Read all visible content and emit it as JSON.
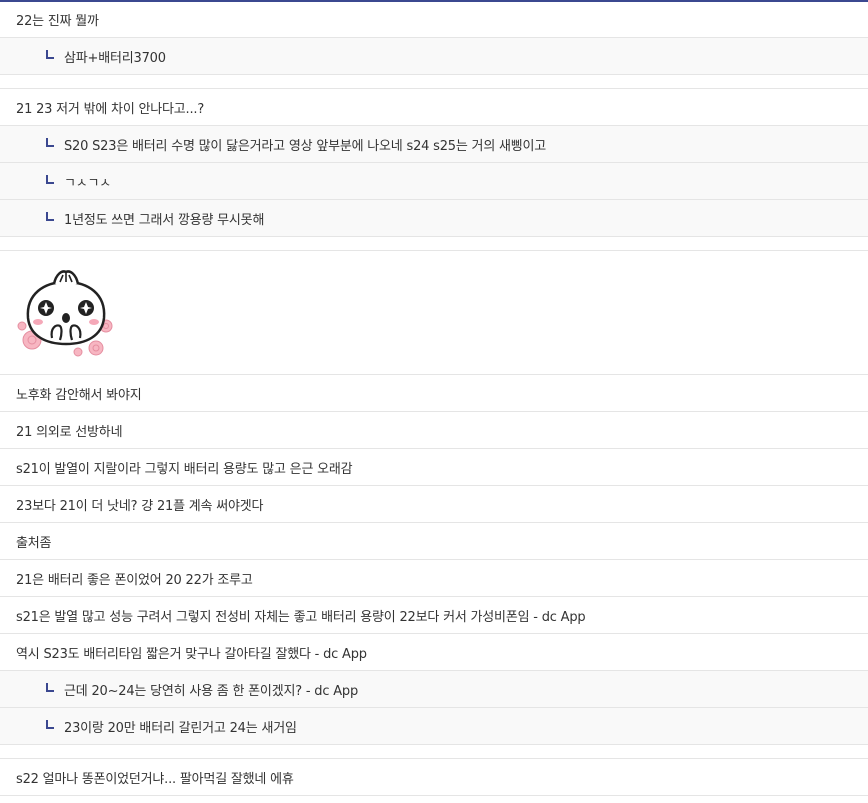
{
  "comments": {
    "c1": "22는 진짜 뭘까",
    "c1_reply1": "삼파+배터리3700",
    "c2": "21 23 저거 밖에 차이 안나다고...?",
    "c2_reply1": "S20 S23은 배터리 수명 많이 닳은거라고 영상 앞부분에 나오네 s24 s25는 거의 새삥이고",
    "c2_reply2": "ㄱㅅㄱㅅ",
    "c2_reply3": "1년정도 쓰면 그래서 깡용량 무시못해",
    "c3_sticker": "dccon-steamed-bun-character",
    "c4": "노후화 감안해서 봐야지",
    "c5": "21 의외로 선방하네",
    "c6": "s21이 발열이 지랄이라 그렇지 배터리 용량도 많고 은근 오래감",
    "c7": "23보다 21이 더 낫네? 걍 21플 계속 써야겟다",
    "c8": "출처좀",
    "c9": "21은 배터리 좋은 폰이었어 20 22가 조루고",
    "c10": "s21은 발열 많고 성능 구려서 그렇지 전성비 자체는 좋고 배터리 용량이 22보다 커서 가성비폰임 - dc App",
    "c11": "역시 S23도 배터리타임 짧은거 맞구나 갈아타길 잘했다 - dc App",
    "c11_reply1": "근데 20~24는 당연히 사용 좀 한 폰이겠지? - dc App",
    "c11_reply2": "23이랑 20만 배터리 갈린거고 24는 새거임",
    "c12": "s22 얼마나 똥폰이었던거냐... 팔아먹길 잘했네 에휴"
  },
  "colors": {
    "accent": "#3b4890",
    "reply_bg": "#f9f9f9",
    "divider": "#e5e5e5",
    "text": "#333333"
  }
}
